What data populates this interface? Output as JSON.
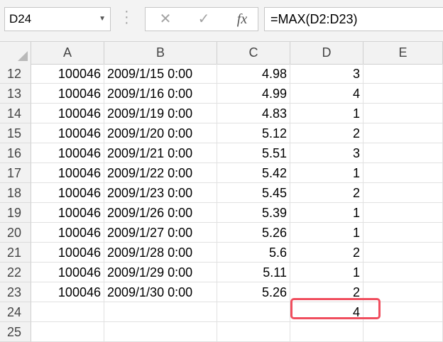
{
  "formula_bar": {
    "name_box": "D24",
    "formula": "=MAX(D2:D23)",
    "cancel_icon": "cancel-icon",
    "enter_icon": "enter-icon",
    "fx_label": "fx"
  },
  "columns": [
    "A",
    "B",
    "C",
    "D",
    "E"
  ],
  "rows": [
    {
      "num": "12",
      "a": "100046",
      "b": "2009/1/15 0:00",
      "c": "4.98",
      "d": "3",
      "e": ""
    },
    {
      "num": "13",
      "a": "100046",
      "b": "2009/1/16 0:00",
      "c": "4.99",
      "d": "4",
      "e": ""
    },
    {
      "num": "14",
      "a": "100046",
      "b": "2009/1/19 0:00",
      "c": "4.83",
      "d": "1",
      "e": ""
    },
    {
      "num": "15",
      "a": "100046",
      "b": "2009/1/20 0:00",
      "c": "5.12",
      "d": "2",
      "e": ""
    },
    {
      "num": "16",
      "a": "100046",
      "b": "2009/1/21 0:00",
      "c": "5.51",
      "d": "3",
      "e": ""
    },
    {
      "num": "17",
      "a": "100046",
      "b": "2009/1/22 0:00",
      "c": "5.42",
      "d": "1",
      "e": ""
    },
    {
      "num": "18",
      "a": "100046",
      "b": "2009/1/23 0:00",
      "c": "5.45",
      "d": "2",
      "e": ""
    },
    {
      "num": "19",
      "a": "100046",
      "b": "2009/1/26 0:00",
      "c": "5.39",
      "d": "1",
      "e": ""
    },
    {
      "num": "20",
      "a": "100046",
      "b": "2009/1/27 0:00",
      "c": "5.26",
      "d": "1",
      "e": ""
    },
    {
      "num": "21",
      "a": "100046",
      "b": "2009/1/28 0:00",
      "c": "5.6",
      "d": "2",
      "e": ""
    },
    {
      "num": "22",
      "a": "100046",
      "b": "2009/1/29 0:00",
      "c": "5.11",
      "d": "1",
      "e": ""
    },
    {
      "num": "23",
      "a": "100046",
      "b": "2009/1/30 0:00",
      "c": "5.26",
      "d": "2",
      "e": ""
    },
    {
      "num": "24",
      "a": "",
      "b": "",
      "c": "",
      "d": "4",
      "e": ""
    },
    {
      "num": "25",
      "a": "",
      "b": "",
      "c": "",
      "d": "",
      "e": ""
    }
  ],
  "highlight_color": "#f04e5e"
}
